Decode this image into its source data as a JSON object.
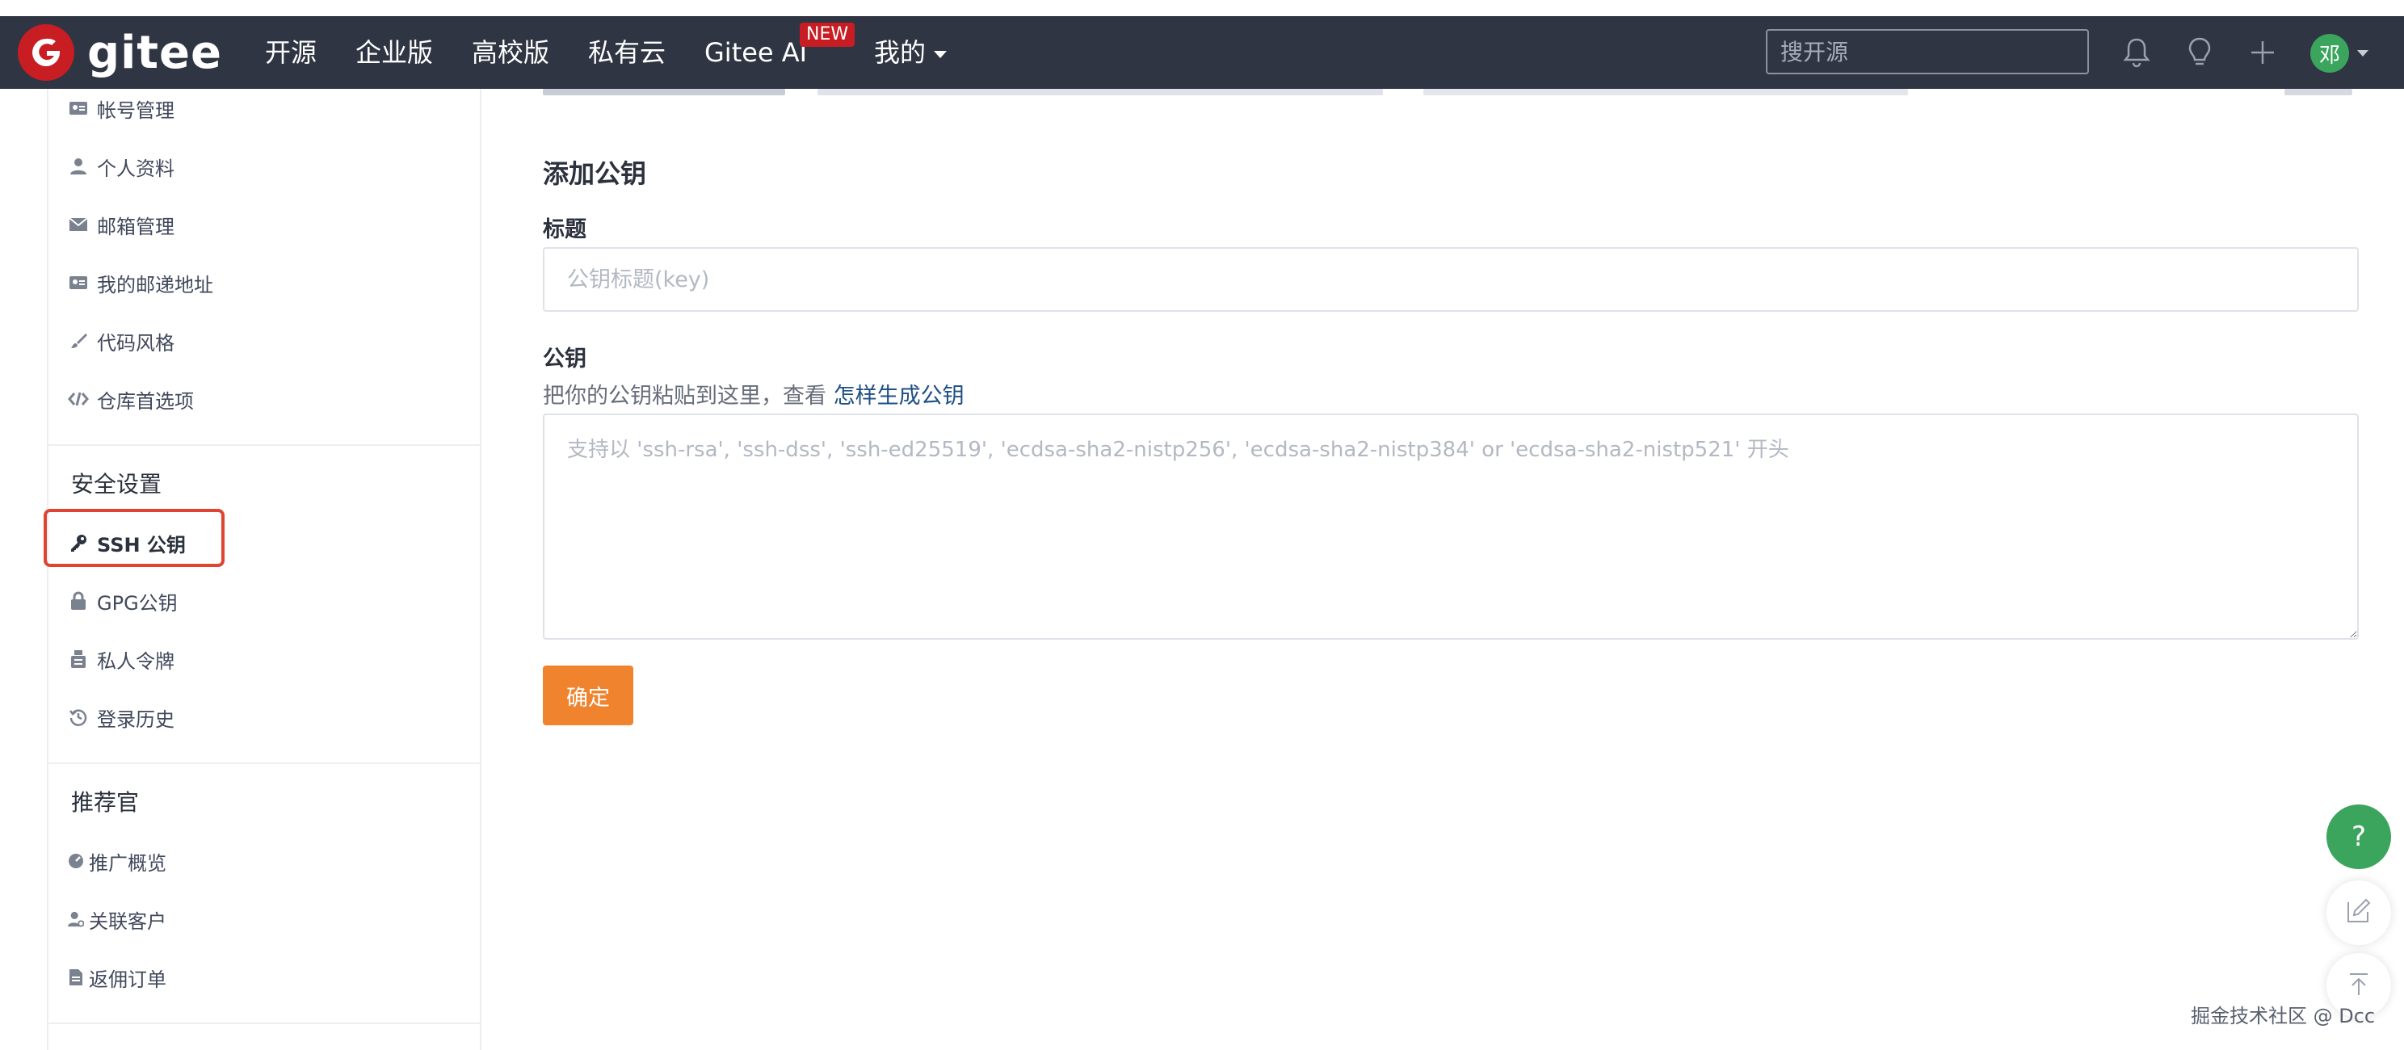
{
  "brand": {
    "logo_letter": "G",
    "name": "gitee",
    "accent": "#c71d23"
  },
  "nav": {
    "items": [
      "开源",
      "企业版",
      "高校版",
      "私有云",
      "Gitee AI"
    ],
    "badge": "NEW",
    "mine": "我的",
    "search_placeholder": "搜开源",
    "avatar_text": "邓"
  },
  "sidebar": {
    "account_items": [
      "帐号管理",
      "个人资料",
      "邮箱管理",
      "我的邮递地址",
      "代码风格",
      "仓库首选项"
    ],
    "security_title": "安全设置",
    "security_items": [
      "SSH 公钥",
      "GPG公钥",
      "私人令牌",
      "登录历史"
    ],
    "recommender_title": "推荐官",
    "recommender_items": [
      "推广概览",
      "关联客户",
      "返佣订单"
    ]
  },
  "main": {
    "section_title": "添加公钥",
    "title_label": "标题",
    "title_placeholder": "公钥标题(key)",
    "key_label": "公钥",
    "key_hint": "把你的公钥粘贴到这里，查看",
    "key_hint_link": "怎样生成公钥",
    "key_placeholder": "支持以 'ssh-rsa', 'ssh-dss', 'ssh-ed25519', 'ecdsa-sha2-nistp256', 'ecdsa-sha2-nistp384' or 'ecdsa-sha2-nistp521' 开头",
    "submit_label": "确定"
  },
  "floating": {
    "help": "?"
  },
  "watermark": "掘金技术社区 @ Dcc"
}
